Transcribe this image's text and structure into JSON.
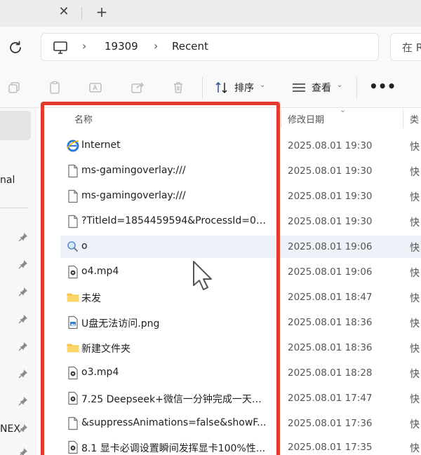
{
  "tabbar": {
    "close_glyph": "✕",
    "new_tab_glyph": "+"
  },
  "address": {
    "refresh_icon": "refresh-icon",
    "computer_icon": "computer-icon",
    "crumbs": [
      "19309",
      "Recent"
    ],
    "search_placeholder": "在 R"
  },
  "toolbar": {
    "icons": [
      "copy-icon",
      "paste-icon",
      "rename-icon",
      "share-icon",
      "delete-icon"
    ],
    "sort_label": "排序",
    "view_label": "查看",
    "more_glyph": "•••"
  },
  "nav": {
    "partial_label_1": "nal",
    "partial_label_2": "NEX"
  },
  "columns": {
    "name": "名称",
    "date": "修改日期",
    "type": "类"
  },
  "files": [
    {
      "name": "Internet",
      "date": "2025.08.01 19:30",
      "type": "快",
      "icon": "internet-explorer-icon"
    },
    {
      "name": "ms-gamingoverlay:///",
      "date": "2025.08.01 19:30",
      "type": "快",
      "icon": "file-icon"
    },
    {
      "name": "ms-gamingoverlay:///",
      "date": "2025.08.01 19:30",
      "type": "快",
      "icon": "file-icon"
    },
    {
      "name": "?TitleId=1854459594&ProcessId=0&...",
      "date": "2025.08.01 19:30",
      "type": "快",
      "icon": "file-icon"
    },
    {
      "name": "o",
      "date": "2025.08.01 19:06",
      "type": "快",
      "icon": "search-icon"
    },
    {
      "name": "o4.mp4",
      "date": "2025.08.01 19:06",
      "type": "快",
      "icon": "video-file-icon"
    },
    {
      "name": "未发",
      "date": "2025.08.01 18:47",
      "type": "快",
      "icon": "folder-icon"
    },
    {
      "name": "U盘无法访问.png",
      "date": "2025.08.01 18:36",
      "type": "快",
      "icon": "image-file-icon"
    },
    {
      "name": "新建文件夹",
      "date": "2025.08.01 18:36",
      "type": "快",
      "icon": "folder-icon"
    },
    {
      "name": "o3.mp4",
      "date": "2025.08.01 18:28",
      "type": "快",
      "icon": "video-file-icon"
    },
    {
      "name": "7.25 Deepseek+微信一分钟完成一天工...",
      "date": "2025.08.01 17:47",
      "type": "快",
      "icon": "video-file-icon"
    },
    {
      "name": "&suppressAnimations=false&showF...",
      "date": "2025.08.01 17:36",
      "type": "快",
      "icon": "file-icon"
    },
    {
      "name": "8.1 显卡必调设置瞬间发挥显卡100%性...",
      "date": "2025.08.01 17:35",
      "type": "快",
      "icon": "video-file-icon"
    }
  ],
  "colors": {
    "highlight_frame": "#e33a2b",
    "selected_row": "#eef2f8",
    "folder": "#f5c242"
  }
}
